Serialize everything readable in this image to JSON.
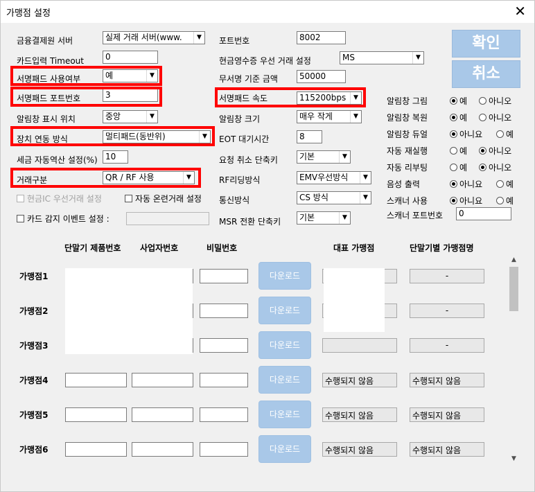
{
  "window": {
    "title": "가맹점 설정",
    "close": "✕"
  },
  "buttons": {
    "ok": "확인",
    "cancel": "취소"
  },
  "col1": {
    "server_label": "금융결제원 서버",
    "server_value": "실제 거래 서버(www.",
    "timeout_label": "카드입력 Timeout",
    "timeout_value": "0",
    "signpad_use_label": "서명패드 사용여부",
    "signpad_use_value": "예",
    "signpad_port_label": "서명패드 포트번호",
    "signpad_port_value": "3",
    "alert_pos_label": "알림창 표시 위치",
    "alert_pos_value": "중앙",
    "device_link_label": "장치 연동 방식",
    "device_link_value": "멀티패드(동반위)",
    "tax_label": "세금 자동역산 설정(%)",
    "tax_value": "10",
    "trans_type_label": "거래구분",
    "trans_type_value": "QR / RF 사용",
    "cash_ic_label": "현금IC 우선거래 설정",
    "auto_trade_label": "자동 온련거래 설정",
    "card_event_label": "카드 감지 이벤트 설정 :"
  },
  "col2": {
    "port_label": "포트번호",
    "port_value": "8002",
    "cash_receipt_label": "현금영수증 우선 거래 설정",
    "cash_receipt_value": "MS",
    "nosign_label": "무서명 기준 금액",
    "nosign_value": "50000",
    "signpad_speed_label": "서명패드 속도",
    "signpad_speed_value": "115200bps",
    "alert_size_label": "알림창 크기",
    "alert_size_value": "매우 작게",
    "eot_label": "EOT 대기시간",
    "eot_value": "8",
    "cancel_key_label": "요청 취소 단축키",
    "cancel_key_value": "기본",
    "rf_label": "RF리딩방식",
    "rf_value": "EMV우선방식",
    "comm_label": "통신방식",
    "comm_value": "CS 방식",
    "msr_label": "MSR 전환 단축키",
    "msr_value": "기본"
  },
  "col3": {
    "rows": [
      {
        "label": "알림창 그림",
        "opt1": "예",
        "opt2": "아니오",
        "selected": 1
      },
      {
        "label": "알림창 복원",
        "opt1": "예",
        "opt2": "아니오",
        "selected": 1
      },
      {
        "label": "알림창 듀얼",
        "opt1": "아니요",
        "opt2": "예",
        "selected": 1
      },
      {
        "label": "자동 재실행",
        "opt1": "예",
        "opt2": "아니오",
        "selected": 2
      },
      {
        "label": "자동 리부팅",
        "opt1": "예",
        "opt2": "아니오",
        "selected": 2
      },
      {
        "label": "음성 출력",
        "opt1": "아니요",
        "opt2": "예",
        "selected": 1
      },
      {
        "label": "스캐너 사용",
        "opt1": "아니요",
        "opt2": "예",
        "selected": 1
      }
    ],
    "scanner_port_label": "스캐너 포트번호",
    "scanner_port_value": "0"
  },
  "table": {
    "headers": {
      "product": "단말기 제품번호",
      "biz": "사업자번호",
      "pw": "비밀번호",
      "rep": "대표 가맹점",
      "name": "단말기별 가맹점명"
    },
    "download_label": "다운로드",
    "rows": [
      {
        "label": "가맹점1",
        "rep": "",
        "name": "-"
      },
      {
        "label": "가맹점2",
        "rep": "",
        "name": "-"
      },
      {
        "label": "가맹점3",
        "rep": "",
        "name": "-"
      },
      {
        "label": "가맹점4",
        "rep": "수행되지 않음",
        "name": "수행되지 않음"
      },
      {
        "label": "가맹점5",
        "rep": "수행되지 않음",
        "name": "수행되지 않음"
      },
      {
        "label": "가맹점6",
        "rep": "수행되지 않음",
        "name": "수행되지 않음"
      }
    ]
  },
  "colors": {
    "highlight": "#ff0000",
    "button": "#a9c8e8"
  }
}
